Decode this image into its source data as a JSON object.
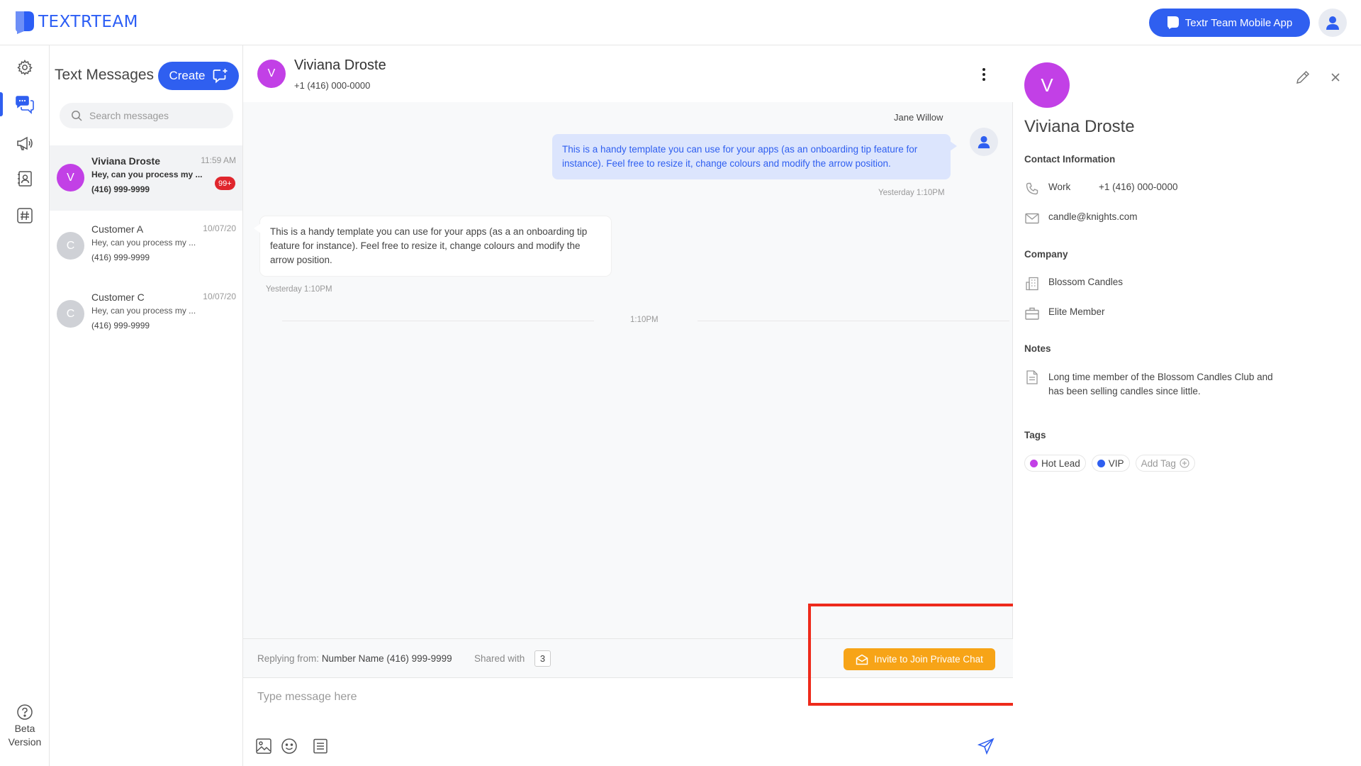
{
  "app": {
    "logo_text": "TEXTRTEAM",
    "mobile_app_button": "Textr Team Mobile App",
    "accent": "#2f5ff0"
  },
  "rail": {
    "items": [
      {
        "icon": "gear-icon"
      },
      {
        "icon": "chat-bubbles-icon",
        "active": true
      },
      {
        "icon": "megaphone-icon"
      },
      {
        "icon": "contacts-icon"
      },
      {
        "icon": "hashtag-icon"
      }
    ],
    "help_line1": "Beta",
    "help_line2": "Version"
  },
  "list": {
    "title": "Text Messages",
    "create_label": "Create",
    "search_placeholder": "Search messages",
    "conversations": [
      {
        "initial": "V",
        "name": "Viviana Droste",
        "time": "11:59 AM",
        "preview": "Hey, can you process my ...",
        "phone": "(416) 999-9999",
        "badge": "99+",
        "avatar_color": "#c240e6",
        "selected": true
      },
      {
        "initial": "C",
        "name": "Customer A",
        "time": "10/07/20",
        "preview": "Hey, can you process my ...",
        "phone": "(416) 999-9999",
        "avatar_color": "#cfd1d6"
      },
      {
        "initial": "C",
        "name": "Customer C",
        "time": "10/07/20",
        "preview": "Hey, can you process my ...",
        "phone": "(416) 999-9999",
        "avatar_color": "#cfd1d6"
      }
    ]
  },
  "chat": {
    "initial": "V",
    "name": "Viviana Droste",
    "phone": "+1 (416) 000-0000",
    "messages": [
      {
        "direction": "out",
        "sender": "Jane Willow",
        "text": "This is a handy template you can use for your apps (as an onboarding tip feature for instance). Feel free to resize it, change colours and modify the arrow position.",
        "time": "Yesterday 1:10PM"
      },
      {
        "direction": "in",
        "text": "This is a handy template you can use for your apps (as a an onboarding tip feature for instance). Feel free to resize it, change colours and modify the arrow position.",
        "time": "Yesterday 1:10PM"
      }
    ],
    "divider_time": "1:10PM",
    "replying_from_label": "Replying from:",
    "replying_from_value": "Number Name (416) 999-9999",
    "shared_with_label": "Shared with",
    "shared_with_count": "3",
    "invite_button": "Invite to Join Private Chat",
    "invite_color": "#f7a417",
    "composer_placeholder": "Type message here"
  },
  "contact": {
    "initial": "V",
    "name": "Viviana Droste",
    "contact_info_title": "Contact Information",
    "phone_label": "Work",
    "phone_value": "+1 (416) 000-0000",
    "email": "candle@knights.com",
    "company_title": "Company",
    "company_name": "Blossom Candles",
    "membership": "Elite Member",
    "notes_title": "Notes",
    "notes_text": "Long time member of the Blossom Candles Club and has been selling candles since little.",
    "tags_title": "Tags",
    "tags": [
      {
        "label": "Hot Lead",
        "color": "#c240e6"
      },
      {
        "label": "VIP",
        "color": "#2f5ff0"
      }
    ],
    "add_tag_label": "Add Tag"
  }
}
